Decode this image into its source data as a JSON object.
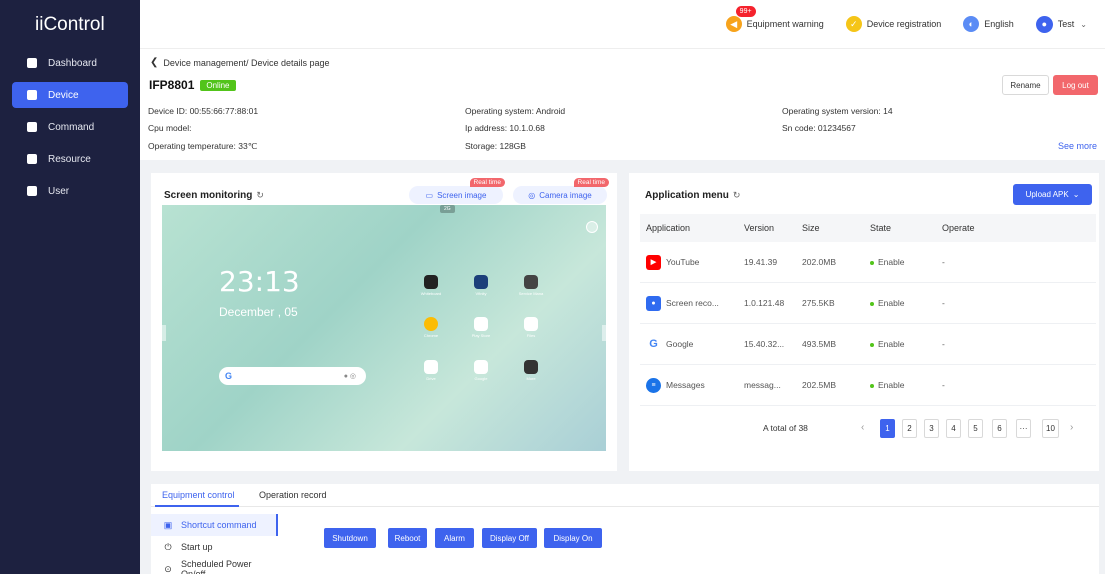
{
  "app": {
    "title": "iiControl"
  },
  "sidebar": {
    "items": [
      {
        "label": "Dashboard",
        "icon": "dashboard-icon"
      },
      {
        "label": "Device",
        "icon": "device-icon",
        "active": true
      },
      {
        "label": "Command",
        "icon": "command-icon"
      },
      {
        "label": "Resource",
        "icon": "resource-icon"
      },
      {
        "label": "User",
        "icon": "user-icon"
      }
    ]
  },
  "topbar": {
    "warning_badge": "99+",
    "warning_label": "Equipment warning",
    "registration_label": "Device registration",
    "language_label": "English",
    "user_label": "Test"
  },
  "device": {
    "breadcrumb_parent": "Device management",
    "breadcrumb_current": "/ Device details page",
    "name": "IFP8801",
    "status": "Online",
    "rename_label": "Rename",
    "logout_label": "Log out",
    "see_more": "See more",
    "info": {
      "device_id": "Device ID: 00:55:66:77:88:01",
      "cpu_model": "Cpu model:",
      "operating_temperature": "Operating temperature: 33℃",
      "operating_system": "Operating system: Android",
      "ip_address": "Ip address: 10.1.0.68",
      "storage": "Storage: 128GB",
      "os_version": "Operating system version: 14",
      "sn_code": "Sn code: 01234567"
    }
  },
  "monitor": {
    "title": "Screen monitoring",
    "screen_image_label": "Screen image",
    "camera_image_label": "Camera image",
    "realtime_tag": "Real time",
    "screen": {
      "time": "23:13",
      "date": "December , 05",
      "search_glyph": "G",
      "top_chip": "2G",
      "apps": [
        "Whiteboard",
        "Vfinity",
        "Service Mana",
        "Chrome",
        "Play Store",
        "Files",
        "Drive",
        "Google",
        "More"
      ]
    }
  },
  "appmenu": {
    "title": "Application menu",
    "upload_label": "Upload APK",
    "columns": [
      "Application",
      "Version",
      "Size",
      "State",
      "Operate"
    ],
    "rows": [
      {
        "name": "YouTube",
        "version": "19.41.39",
        "size": "202.0MB",
        "state": "Enable",
        "operate": "-",
        "color": "#ff0000",
        "glyph": "▶"
      },
      {
        "name": "Screen reco...",
        "version": "1.0.121.48",
        "size": "275.5KB",
        "state": "Enable",
        "operate": "-",
        "color": "#2f6bf0",
        "glyph": "●"
      },
      {
        "name": "Google",
        "version": "15.40.32...",
        "size": "493.5MB",
        "state": "Enable",
        "operate": "-",
        "color": "#4285f4",
        "glyph": "G"
      },
      {
        "name": "Messages",
        "version": "messag...",
        "size": "202.5MB",
        "state": "Enable",
        "operate": "-",
        "color": "#1a73e8",
        "glyph": "≡"
      }
    ],
    "pager": {
      "total": "A total of 38",
      "pages": [
        "1",
        "2",
        "3",
        "4",
        "5",
        "6",
        "···",
        "10"
      ],
      "current": "1"
    }
  },
  "bottom": {
    "tabs": [
      "Equipment control",
      "Operation record"
    ],
    "menu": [
      {
        "label": "Shortcut command",
        "icon": "▣"
      },
      {
        "label": "Start up",
        "icon": "⏻"
      },
      {
        "label": "Scheduled Power On/off",
        "icon": "⊙"
      }
    ],
    "buttons": [
      "Shutdown",
      "Reboot",
      "Alarm",
      "Display Off",
      "Display On"
    ]
  }
}
